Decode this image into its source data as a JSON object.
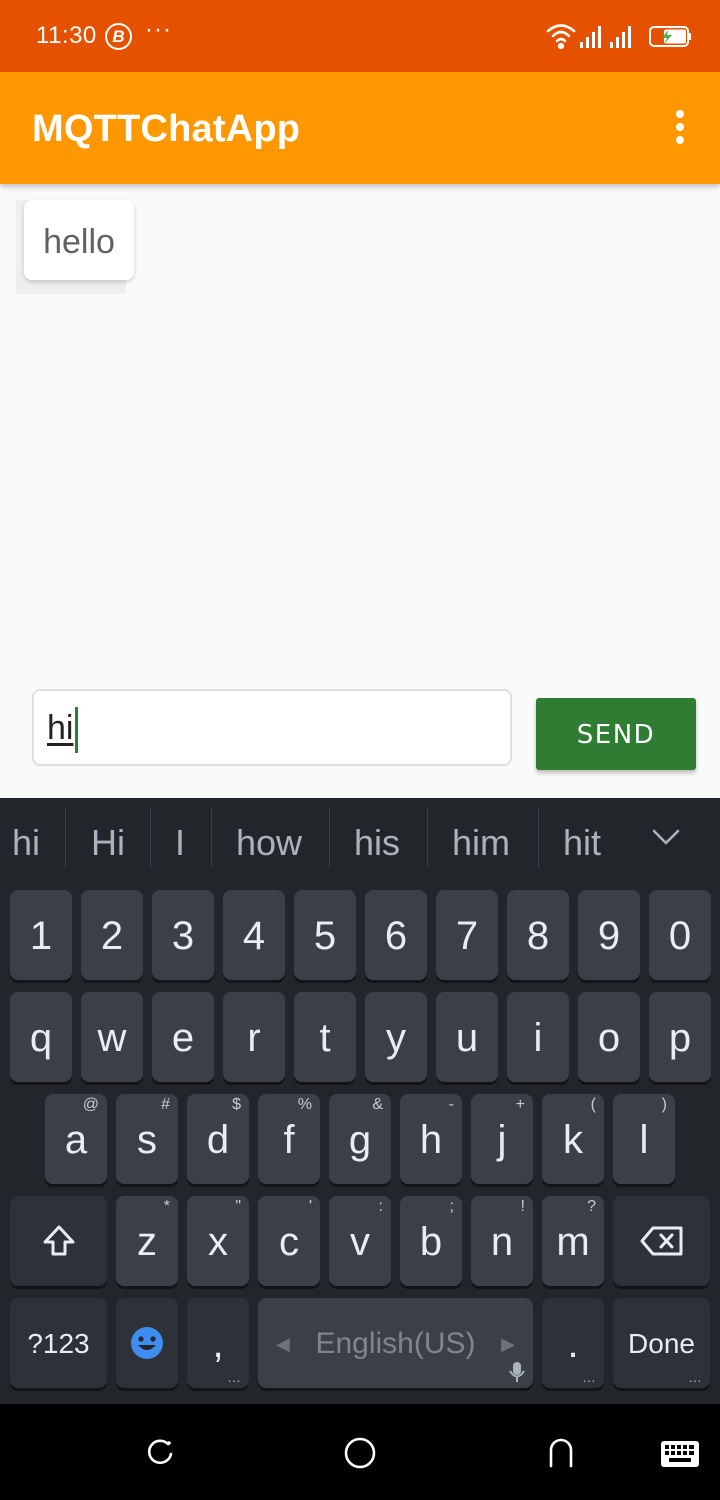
{
  "status_bar": {
    "time": "11:30",
    "badge": "B",
    "more": "···"
  },
  "app_bar": {
    "title": "MQTTChatApp",
    "color": "#ff9800"
  },
  "status_color": "#e65100",
  "chat": {
    "messages": [
      "hello"
    ]
  },
  "composer": {
    "input_value": "hi",
    "send_label": "SEND",
    "send_color": "#2e7d32"
  },
  "keyboard": {
    "suggestions": [
      "hi",
      "Hi",
      "I",
      "how",
      "his",
      "him",
      "hit"
    ],
    "row_numbers": [
      "1",
      "2",
      "3",
      "4",
      "5",
      "6",
      "7",
      "8",
      "9",
      "0"
    ],
    "row_top": [
      "q",
      "w",
      "e",
      "r",
      "t",
      "y",
      "u",
      "i",
      "o",
      "p"
    ],
    "row_middle": [
      {
        "key": "a",
        "sym": "@"
      },
      {
        "key": "s",
        "sym": "#"
      },
      {
        "key": "d",
        "sym": "$"
      },
      {
        "key": "f",
        "sym": "%"
      },
      {
        "key": "g",
        "sym": "&"
      },
      {
        "key": "h",
        "sym": "-"
      },
      {
        "key": "j",
        "sym": "+"
      },
      {
        "key": "k",
        "sym": "("
      },
      {
        "key": "l",
        "sym": ")"
      }
    ],
    "row_bottom": [
      {
        "key": "z",
        "sym": "*"
      },
      {
        "key": "x",
        "sym": "\""
      },
      {
        "key": "c",
        "sym": "'"
      },
      {
        "key": "v",
        "sym": ":"
      },
      {
        "key": "b",
        "sym": ";"
      },
      {
        "key": "n",
        "sym": "!"
      },
      {
        "key": "m",
        "sym": "?"
      }
    ],
    "symbols_label": "?123",
    "comma": ",",
    "space_label": "English(US)",
    "period": ".",
    "done_label": "Done",
    "more_dots": "…"
  }
}
